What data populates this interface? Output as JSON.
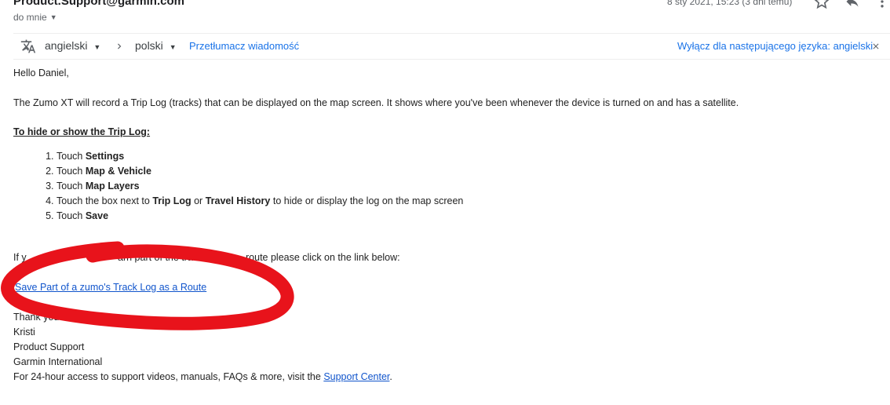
{
  "header": {
    "sender": "Product.Support@garmin.com",
    "to": "do mnie",
    "date": "8 sty 2021, 15:23 (3 dni temu)",
    "icons": [
      "dropdown-caret-icon",
      "star-icon",
      "reply-icon",
      "more-vert-icon"
    ]
  },
  "translate": {
    "source_lang": "angielski",
    "target_lang": "polski",
    "translate_link": "Przetłumacz wiadomość",
    "disable_link": "Wyłącz dla następującego języka: angielski",
    "icons": [
      "translate-icon",
      "chevron-right-icon",
      "close-icon"
    ]
  },
  "email": {
    "greeting": "Hello Daniel,",
    "intro": "The Zumo XT will record a Trip Log (tracks) that can be displayed on the map screen. It shows where you've been whenever the device is turned on and has a satellite.",
    "heading": "To hide or show the Trip Log:",
    "steps": [
      {
        "pre": "Touch ",
        "b1": "Settings"
      },
      {
        "pre": "Touch ",
        "b1": "Map & Vehicle"
      },
      {
        "pre": "Touch ",
        "b1": "Map Layers"
      },
      {
        "pre": "Touch the box next to ",
        "b1": "Trip Log",
        "mid": " or ",
        "b2": "Travel History",
        "post": " to hide or display the log on the map screen"
      },
      {
        "pre": "Touch ",
        "b1": "Save"
      }
    ],
    "route_line_left": "If y",
    "route_line_mid": "arn part of the track",
    "route_line_right": "route please click on the link below:",
    "link": "Save Part of a zumo's Track Log as a Route",
    "thanks": "Thank you for",
    "sig_name": "Kristi",
    "sig_dept": "Product Support",
    "sig_company": "Garmin International",
    "support_pre": "For 24-hour access to support videos, manuals, FAQs & more, visit the ",
    "support_link": "Support Center",
    "support_post": "."
  },
  "annotation": {
    "color": "#e8131b"
  }
}
